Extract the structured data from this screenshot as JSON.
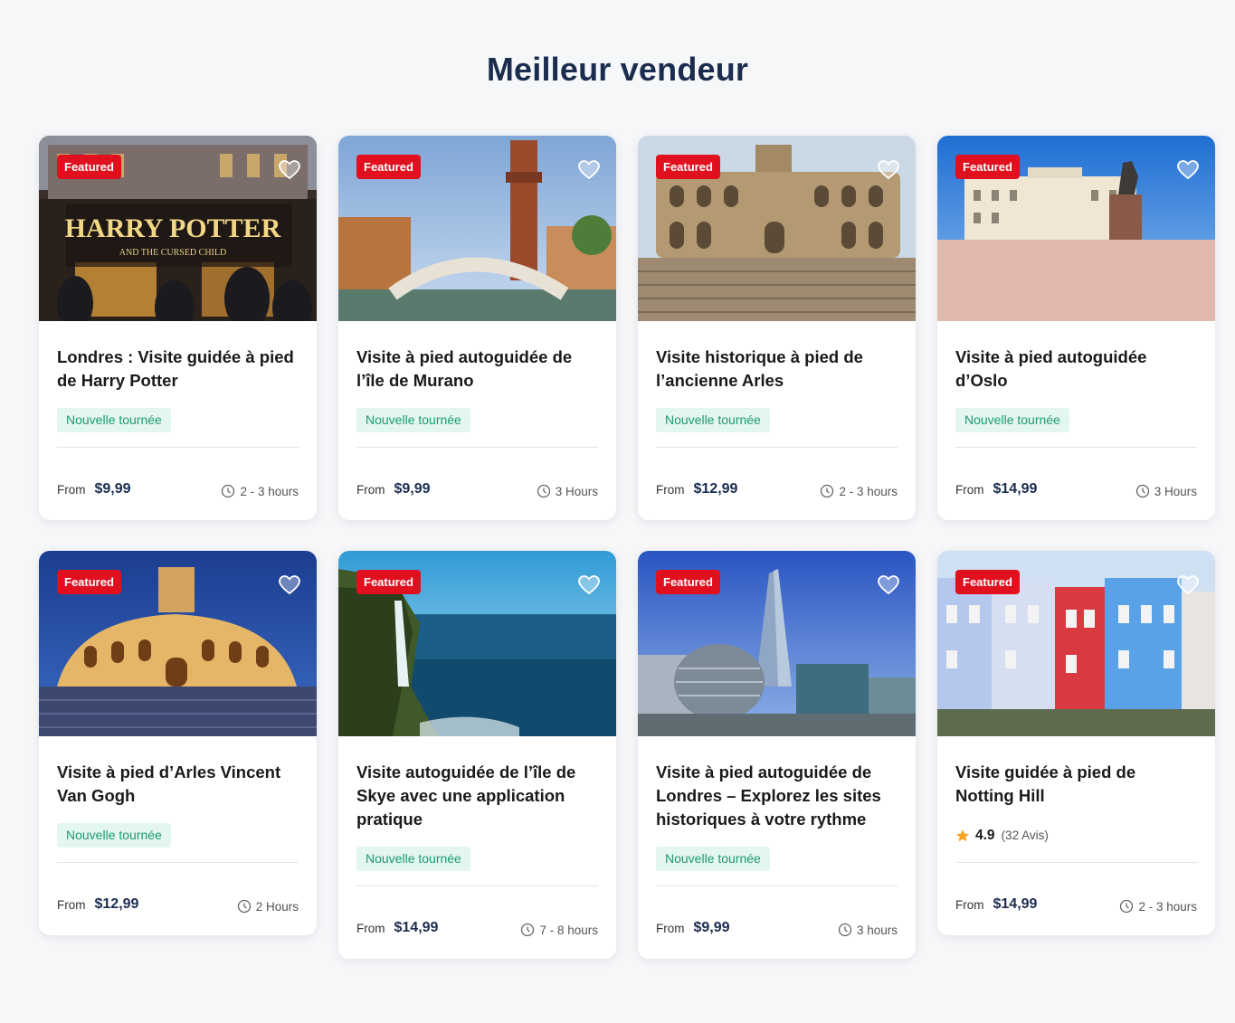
{
  "section": {
    "title": "Meilleur vendeur"
  },
  "cards": [
    {
      "title": "Londres : Visite guidée à pied de Harry Potter",
      "badge": "Featured",
      "tag": "Nouvelle tournée",
      "from": "From",
      "price": "$9,99",
      "duration": "2 - 3 hours",
      "image_text": "HARRY POTTER"
    },
    {
      "title": "Visite à pied autoguidée de l’île de Murano",
      "badge": "Featured",
      "tag": "Nouvelle tournée",
      "from": "From",
      "price": "$9,99",
      "duration": "3 Hours"
    },
    {
      "title": "Visite historique à pied de l’ancienne Arles",
      "badge": "Featured",
      "tag": "Nouvelle tournée",
      "from": "From",
      "price": "$12,99",
      "duration": "2 - 3 hours"
    },
    {
      "title": "Visite à pied autoguidée d’Oslo",
      "badge": "Featured",
      "tag": "Nouvelle tournée",
      "from": "From",
      "price": "$14,99",
      "duration": "3 Hours"
    },
    {
      "title": "Visite à pied d’Arles Vincent Van Gogh",
      "badge": "Featured",
      "tag": "Nouvelle tournée",
      "from": "From",
      "price": "$12,99",
      "duration": "2 Hours"
    },
    {
      "title": "Visite autoguidée de l’île de Skye avec une application pratique",
      "badge": "Featured",
      "tag": "Nouvelle tournée",
      "from": "From",
      "price": "$14,99",
      "duration": "7 - 8 hours"
    },
    {
      "title": "Visite à pied autoguidée de Londres – Explorez les sites historiques à votre rythme",
      "badge": "Featured",
      "tag": "Nouvelle tournée",
      "from": "From",
      "price": "$9,99",
      "duration": "3 hours"
    },
    {
      "title": "Visite guidée à pied de Notting Hill",
      "badge": "Featured",
      "rating": "4.9",
      "reviews": "(32 Avis)",
      "from": "From",
      "price": "$14,99",
      "duration": "2 - 3 hours"
    }
  ],
  "icons": {
    "favorite": "heart-icon",
    "duration": "clock-icon",
    "rating": "star-icon"
  },
  "colors": {
    "badge": "#e0101f",
    "tag_bg": "#e3f6f0",
    "tag_text": "#1e9a73",
    "title": "#1b2d4f",
    "star": "#f5a623"
  }
}
